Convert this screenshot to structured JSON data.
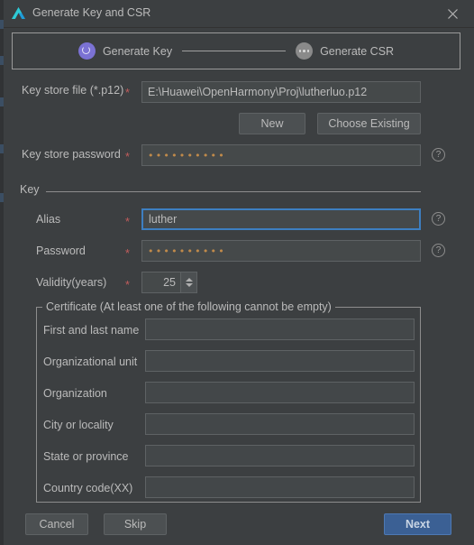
{
  "window": {
    "title": "Generate Key and CSR",
    "app_icon": "deveco-logo-icon",
    "close_icon": "close-icon"
  },
  "stepper": {
    "steps": [
      {
        "label": "Generate Key",
        "state": "active",
        "icon": "ring-icon"
      },
      {
        "label": "Generate CSR",
        "state": "inactive",
        "icon": "ellipsis-icon"
      }
    ]
  },
  "form": {
    "keystore_file": {
      "label": "Key store file (*.p12)",
      "required_marker": "*",
      "value": "E:\\Huawei\\OpenHarmony\\Proj\\lutherluo.p12",
      "placeholder": ""
    },
    "new_button": "New",
    "choose_existing_button": "Choose Existing",
    "keystore_password": {
      "label": "Key store password",
      "required_marker": "*",
      "value": "••••••••••",
      "help_icon": "help-icon"
    }
  },
  "key_group": {
    "title": "Key",
    "alias": {
      "label": "Alias",
      "required_marker": "*",
      "value": "luther",
      "help_icon": "help-icon"
    },
    "password": {
      "label": "Password",
      "required_marker": "*",
      "value": "••••••••••",
      "help_icon": "help-icon"
    },
    "validity": {
      "label": "Validity(years)",
      "required_marker": "*",
      "value": "25"
    }
  },
  "certificate_group": {
    "legend": "Certificate (At least one of the following cannot be empty)",
    "fields": [
      {
        "label": "First and last name",
        "value": ""
      },
      {
        "label": "Organizational unit",
        "value": ""
      },
      {
        "label": "Organization",
        "value": ""
      },
      {
        "label": "City or locality",
        "value": ""
      },
      {
        "label": "State or province",
        "value": ""
      },
      {
        "label": "Country code(XX)",
        "value": ""
      }
    ]
  },
  "footer": {
    "cancel": "Cancel",
    "skip": "Skip",
    "next": "Next"
  },
  "colors": {
    "dialog_bg": "#3c3f41",
    "field_bg": "#45494a",
    "border": "#5e6264",
    "accent_primary": "#3b6094",
    "focus_border": "#3d7fc1",
    "step_active": "#7b72d4",
    "step_inactive": "#8a8a8a",
    "required": "#c25c5c",
    "text": "#bbbbbb"
  }
}
